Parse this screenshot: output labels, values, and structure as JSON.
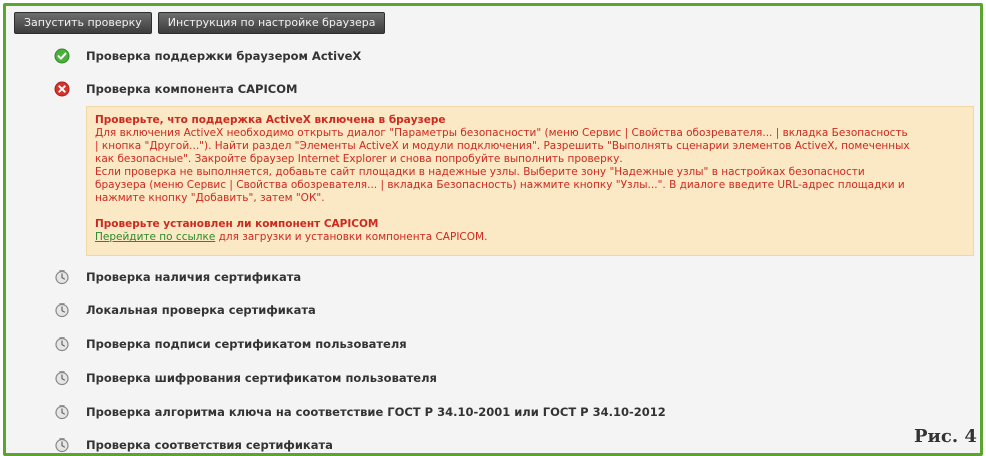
{
  "toolbar": {
    "run_check": "Запустить проверку",
    "browser_instructions": "Инструкция по настройке браузера"
  },
  "checks": [
    {
      "label": "Проверка поддержки браузером ActiveX",
      "status": "ok"
    },
    {
      "label": "Проверка компонента CAPICOM",
      "status": "error"
    },
    {
      "label": "Проверка наличия сертификата",
      "status": "pending"
    },
    {
      "label": "Локальная проверка сертификата",
      "status": "pending"
    },
    {
      "label": "Проверка подписи сертификатом пользователя",
      "status": "pending"
    },
    {
      "label": "Проверка шифрования сертификатом пользователя",
      "status": "pending"
    },
    {
      "label": "Проверка алгоритма ключа на соответствие ГОСТ Р 34.10-2001 или ГОСТ Р 34.10-2012",
      "status": "pending"
    },
    {
      "label": "Проверка соответствия сертификата",
      "status": "pending"
    }
  ],
  "error_panel": {
    "activex_title": "Проверьте, что поддержка ActiveX включена в браузере",
    "activex_line1": "Для включения ActiveX необходимо открыть диалог \"Параметры безопасности\" (меню Сервис | Свойства обозревателя... | вкладка Безопасность",
    "activex_line2": "| кнопка \"Другой...\"). Найти раздел \"Элементы ActiveX и модули подключения\". Разрешить \"Выполнять сценарии элементов ActiveX, помеченных",
    "activex_line3": "как безопасные\". Закройте браузер Internet Explorer и снова попробуйте выполнить проверку.",
    "trusted_line1": "Если проверка не выполняется, добавьте сайт площадки в надежные узлы. Выберите зону \"Надежные узлы\" в настройках безопасности",
    "trusted_line2": "браузера (меню Сервис | Свойства обозревателя... | вкладка Безопасность) нажмите кнопку \"Узлы...\". В диалоге введите URL-адрес площадки и",
    "trusted_line3": "нажмите кнопку \"Добавить\", затем \"ОК\".",
    "capicom_title": "Проверьте установлен ли компонент CAPICOM",
    "capicom_link": "Перейдите по ссылке",
    "capicom_text": " для загрузки и установки компонента CAPICOM."
  },
  "figure_label": "Рис. 4",
  "colors": {
    "frame_border": "#5aa52e",
    "ok_green": "#4caf3c",
    "error_red": "#d9312a",
    "panel_bg": "#fbe8c4",
    "panel_text": "#cc2a20",
    "link_green": "#2c8a2c"
  },
  "icons": {
    "ok": "check-circle-icon",
    "error": "error-circle-icon",
    "pending": "clock-icon"
  }
}
